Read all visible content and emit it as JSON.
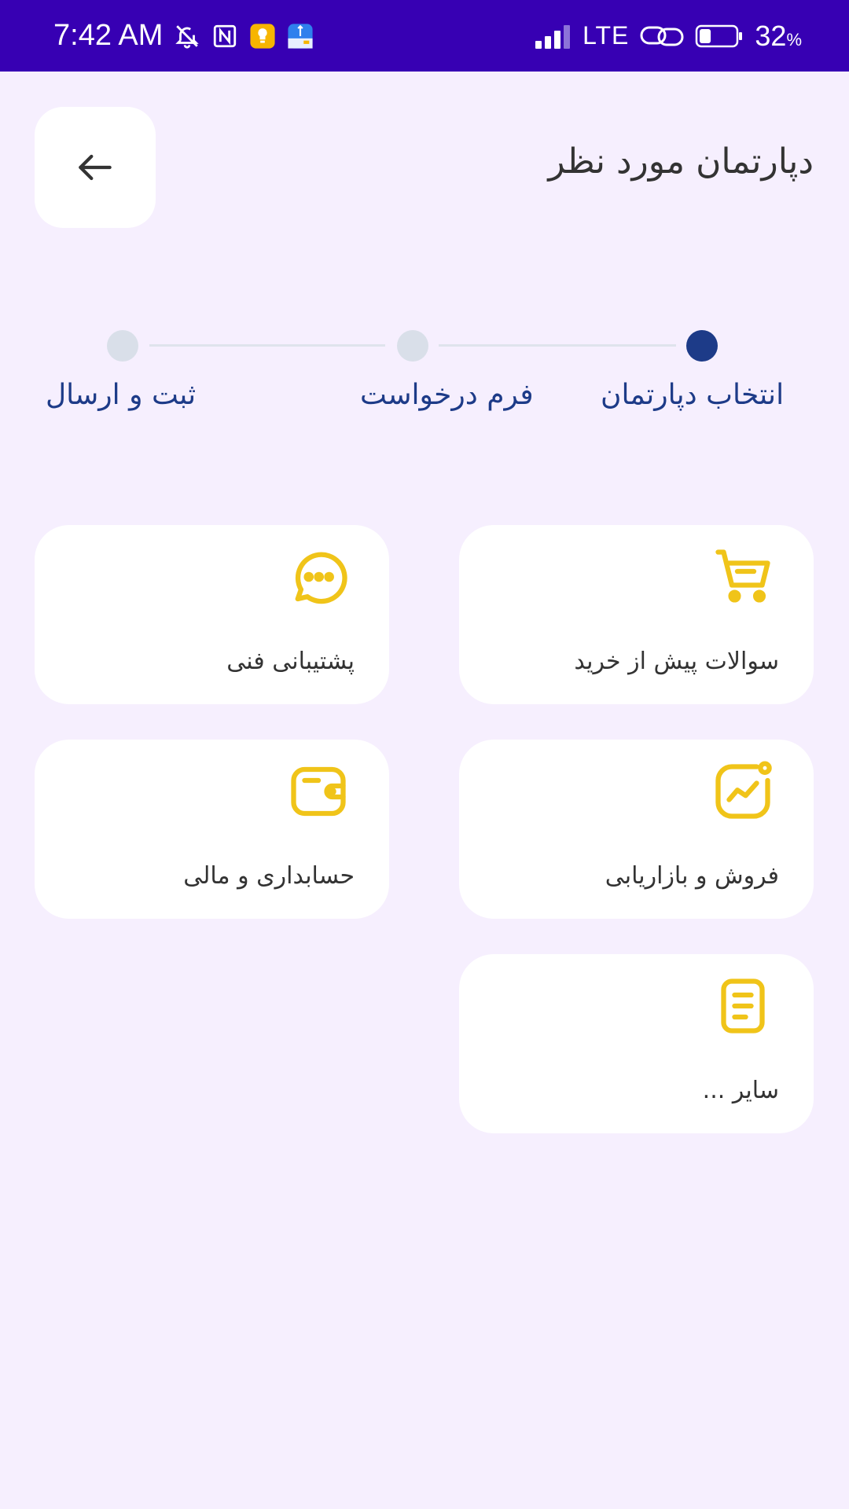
{
  "status_bar": {
    "time": "7:42 AM",
    "network": "LTE",
    "battery_percent": "32",
    "battery_symbol": "%",
    "battery_level": 0.32,
    "icons": [
      "bell-off-icon",
      "nfc-icon",
      "bulb-app-icon",
      "usb-app-icon",
      "signal-icon",
      "link-icon",
      "battery-icon"
    ]
  },
  "header": {
    "title": "دپارتمان مورد نظر",
    "back_icon": "arrow-left-icon"
  },
  "stepper": {
    "steps": [
      {
        "label": "انتخاب دپارتمان",
        "active": true
      },
      {
        "label": "فرم درخواست",
        "active": false
      },
      {
        "label": "ثبت و ارسال",
        "active": false
      }
    ]
  },
  "departments": [
    {
      "label": "سوالات پیش از خرید",
      "icon": "shopping-cart-icon"
    },
    {
      "label": "پشتیبانی فنی",
      "icon": "chat-bubble-icon"
    },
    {
      "label": "فروش و بازاریابی",
      "icon": "chart-growth-icon"
    },
    {
      "label": "حسابداری و مالی",
      "icon": "wallet-icon"
    },
    {
      "label": "سایر ...",
      "icon": "document-icon"
    }
  ],
  "colors": {
    "status_bar": "#3700b3",
    "background": "#f6effe",
    "accent": "#f0c419",
    "step_active": "#1d3b88",
    "step_inactive": "#d9dfe9"
  }
}
